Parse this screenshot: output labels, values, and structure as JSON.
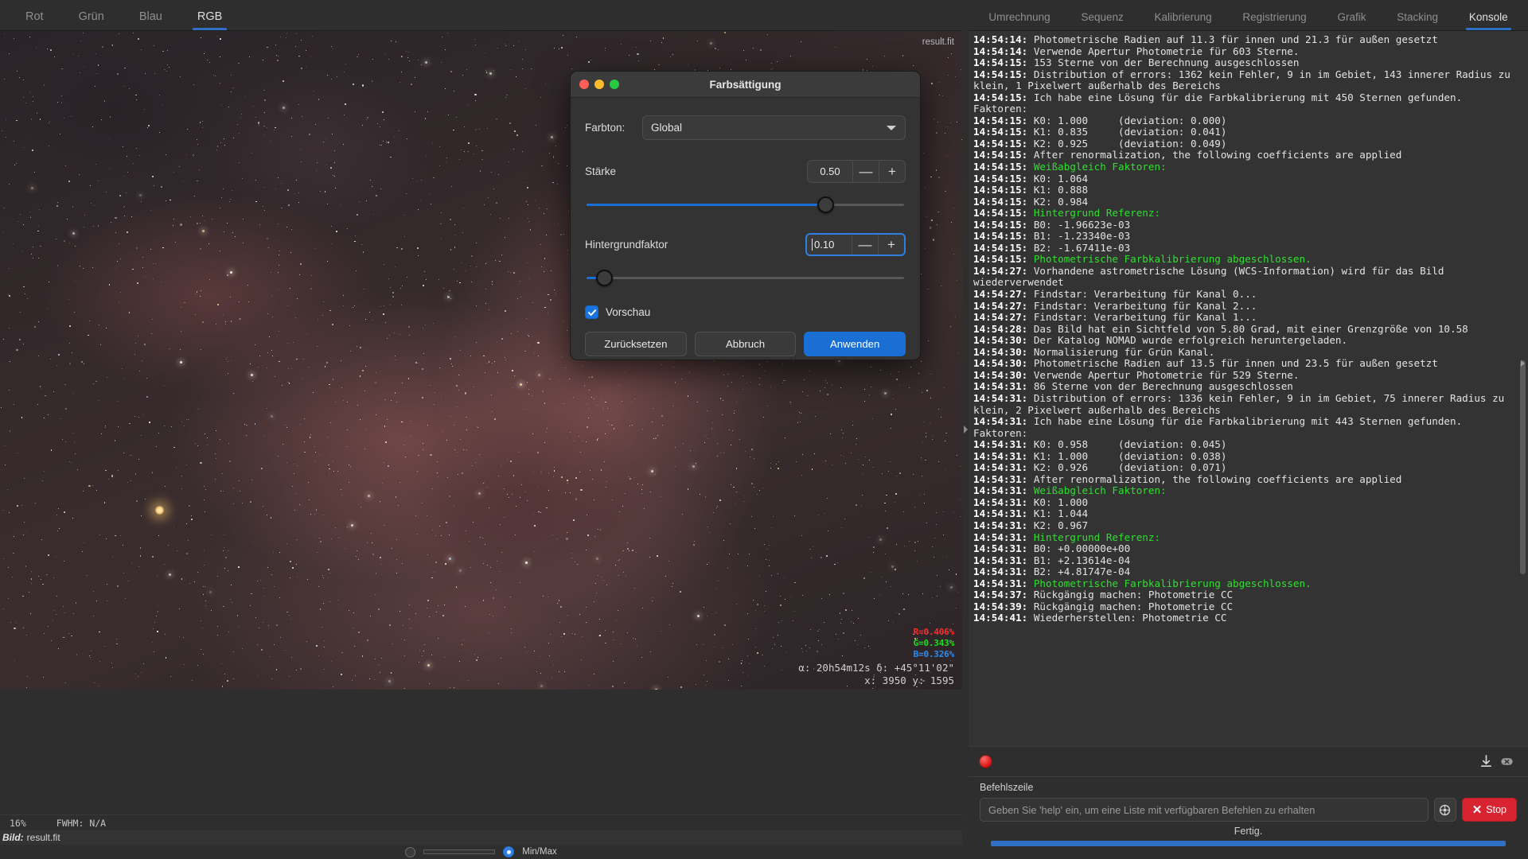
{
  "channel_tabs": [
    {
      "label": "Rot",
      "active": false
    },
    {
      "label": "Grün",
      "active": false
    },
    {
      "label": "Blau",
      "active": false
    },
    {
      "label": "RGB",
      "active": true
    }
  ],
  "image_view": {
    "filename": "result.fit",
    "readout_r": "R=0.406%",
    "readout_g": "G=0.343%",
    "readout_b": "B=0.326%",
    "coords_sky": "α: 20h54m12s δ: +45°11'02\"",
    "coords_pixel": "x: 3950 y: 1595"
  },
  "status_bar": {
    "zoom": "16%",
    "fwhm": "FWHM: N/A",
    "image_key": "Bild:",
    "image_value": "result.fit",
    "minmax_label": "Min/Max"
  },
  "dialog": {
    "title": "Farbsättigung",
    "hue_label": "Farbton:",
    "hue_value": "Global",
    "strength_label": "Stärke",
    "strength_value": "0.50",
    "strength_minus": "—",
    "strength_plus": "+",
    "background_label": "Hintergrundfaktor",
    "background_value": "0.10",
    "background_minus": "—",
    "background_plus": "+",
    "preview_label": "Vorschau",
    "buttons": {
      "reset": "Zurücksetzen",
      "cancel": "Abbruch",
      "apply": "Anwenden"
    }
  },
  "process_tabs": [
    {
      "label": "Umrechnung",
      "active": false
    },
    {
      "label": "Sequenz",
      "active": false
    },
    {
      "label": "Kalibrierung",
      "active": false
    },
    {
      "label": "Registrierung",
      "active": false
    },
    {
      "label": "Grafik",
      "active": false
    },
    {
      "label": "Stacking",
      "active": false
    },
    {
      "label": "Konsole",
      "active": true
    }
  ],
  "console_lines": [
    {
      "ts": "14:54:14:",
      "msg": " Photometrische Radien auf 11.3 für innen und 21.3 für außen gesetzt",
      "green": false
    },
    {
      "ts": "14:54:14:",
      "msg": " Verwende Apertur Photometrie für 603 Sterne.",
      "green": false
    },
    {
      "ts": "14:54:15:",
      "msg": " 153 Sterne von der Berechnung ausgeschlossen",
      "green": false
    },
    {
      "ts": "14:54:15:",
      "msg": " Distribution of errors: 1362 kein Fehler, 9 in im Gebiet, 143 innerer Radius zu klein, 1 Pixelwert außerhalb des Bereichs",
      "green": false
    },
    {
      "ts": "14:54:15:",
      "msg": " Ich habe eine Lösung für die Farbkalibrierung mit 450 Sternen gefunden. Faktoren:",
      "green": false
    },
    {
      "ts": "14:54:15:",
      "msg": " K0: 1.000     (deviation: 0.000)",
      "green": false
    },
    {
      "ts": "14:54:15:",
      "msg": " K1: 0.835     (deviation: 0.041)",
      "green": false
    },
    {
      "ts": "14:54:15:",
      "msg": " K2: 0.925     (deviation: 0.049)",
      "green": false
    },
    {
      "ts": "14:54:15:",
      "msg": " After renormalization, the following coefficients are applied",
      "green": false
    },
    {
      "ts": "14:54:15:",
      "msg": " Weißabgleich Faktoren:",
      "green": true
    },
    {
      "ts": "14:54:15:",
      "msg": " K0: 1.064",
      "green": false
    },
    {
      "ts": "14:54:15:",
      "msg": " K1: 0.888",
      "green": false
    },
    {
      "ts": "14:54:15:",
      "msg": " K2: 0.984",
      "green": false
    },
    {
      "ts": "14:54:15:",
      "msg": " Hintergrund Referenz:",
      "green": true
    },
    {
      "ts": "14:54:15:",
      "msg": " B0: -1.96623e-03",
      "green": false
    },
    {
      "ts": "14:54:15:",
      "msg": " B1: -1.23340e-03",
      "green": false
    },
    {
      "ts": "14:54:15:",
      "msg": " B2: -1.67411e-03",
      "green": false
    },
    {
      "ts": "14:54:15:",
      "msg": " Photometrische Farbkalibrierung abgeschlossen.",
      "green": true
    },
    {
      "ts": "14:54:27:",
      "msg": " Vorhandene astrometrische Lösung (WCS-Information) wird für das Bild wiederverwendet",
      "green": false
    },
    {
      "ts": "14:54:27:",
      "msg": " Findstar: Verarbeitung für Kanal 0...",
      "green": false
    },
    {
      "ts": "14:54:27:",
      "msg": " Findstar: Verarbeitung für Kanal 2...",
      "green": false
    },
    {
      "ts": "14:54:27:",
      "msg": " Findstar: Verarbeitung für Kanal 1...",
      "green": false
    },
    {
      "ts": "14:54:28:",
      "msg": " Das Bild hat ein Sichtfeld von 5.80 Grad, mit einer Grenzgröße von 10.58",
      "green": false
    },
    {
      "ts": "14:54:30:",
      "msg": " Der Katalog NOMAD wurde erfolgreich heruntergeladen.",
      "green": false
    },
    {
      "ts": "14:54:30:",
      "msg": " Normalisierung für Grün Kanal.",
      "green": false
    },
    {
      "ts": "14:54:30:",
      "msg": " Photometrische Radien auf 13.5 für innen und 23.5 für außen gesetzt",
      "green": false
    },
    {
      "ts": "14:54:30:",
      "msg": " Verwende Apertur Photometrie für 529 Sterne.",
      "green": false
    },
    {
      "ts": "14:54:31:",
      "msg": " 86 Sterne von der Berechnung ausgeschlossen",
      "green": false
    },
    {
      "ts": "14:54:31:",
      "msg": " Distribution of errors: 1336 kein Fehler, 9 in im Gebiet, 75 innerer Radius zu klein, 2 Pixelwert außerhalb des Bereichs",
      "green": false
    },
    {
      "ts": "14:54:31:",
      "msg": " Ich habe eine Lösung für die Farbkalibrierung mit 443 Sternen gefunden. Faktoren:",
      "green": false
    },
    {
      "ts": "14:54:31:",
      "msg": " K0: 0.958     (deviation: 0.045)",
      "green": false
    },
    {
      "ts": "14:54:31:",
      "msg": " K1: 1.000     (deviation: 0.038)",
      "green": false
    },
    {
      "ts": "14:54:31:",
      "msg": " K2: 0.926     (deviation: 0.071)",
      "green": false
    },
    {
      "ts": "14:54:31:",
      "msg": " After renormalization, the following coefficients are applied",
      "green": false
    },
    {
      "ts": "14:54:31:",
      "msg": " Weißabgleich Faktoren:",
      "green": true
    },
    {
      "ts": "14:54:31:",
      "msg": " K0: 1.000",
      "green": false
    },
    {
      "ts": "14:54:31:",
      "msg": " K1: 1.044",
      "green": false
    },
    {
      "ts": "14:54:31:",
      "msg": " K2: 0.967",
      "green": false
    },
    {
      "ts": "14:54:31:",
      "msg": " Hintergrund Referenz:",
      "green": true
    },
    {
      "ts": "14:54:31:",
      "msg": " B0: +0.00000e+00",
      "green": false
    },
    {
      "ts": "14:54:31:",
      "msg": " B1: +2.13614e-04",
      "green": false
    },
    {
      "ts": "14:54:31:",
      "msg": " B2: +4.81747e-04",
      "green": false
    },
    {
      "ts": "14:54:31:",
      "msg": " Photometrische Farbkalibrierung abgeschlossen.",
      "green": true
    },
    {
      "ts": "14:54:37:",
      "msg": " Rückgängig machen: Photometrie CC",
      "green": false
    },
    {
      "ts": "14:54:39:",
      "msg": " Rückgängig machen: Photometrie CC",
      "green": false
    },
    {
      "ts": "14:54:41:",
      "msg": " Wiederherstellen: Photometrie CC",
      "green": false
    }
  ],
  "command_line": {
    "label": "Befehlszeile",
    "placeholder": "Geben Sie 'help' ein, um eine Liste mit verfügbaren Befehlen zu erhalten",
    "value": "",
    "stop_label": "Stop",
    "stop_x": "✕",
    "status": "Fertig."
  },
  "colors": {
    "accent_blue": "#2f6fc4",
    "apply_blue": "#1a6fd4",
    "stop_red": "#d82431",
    "log_green": "#2ee02e"
  }
}
